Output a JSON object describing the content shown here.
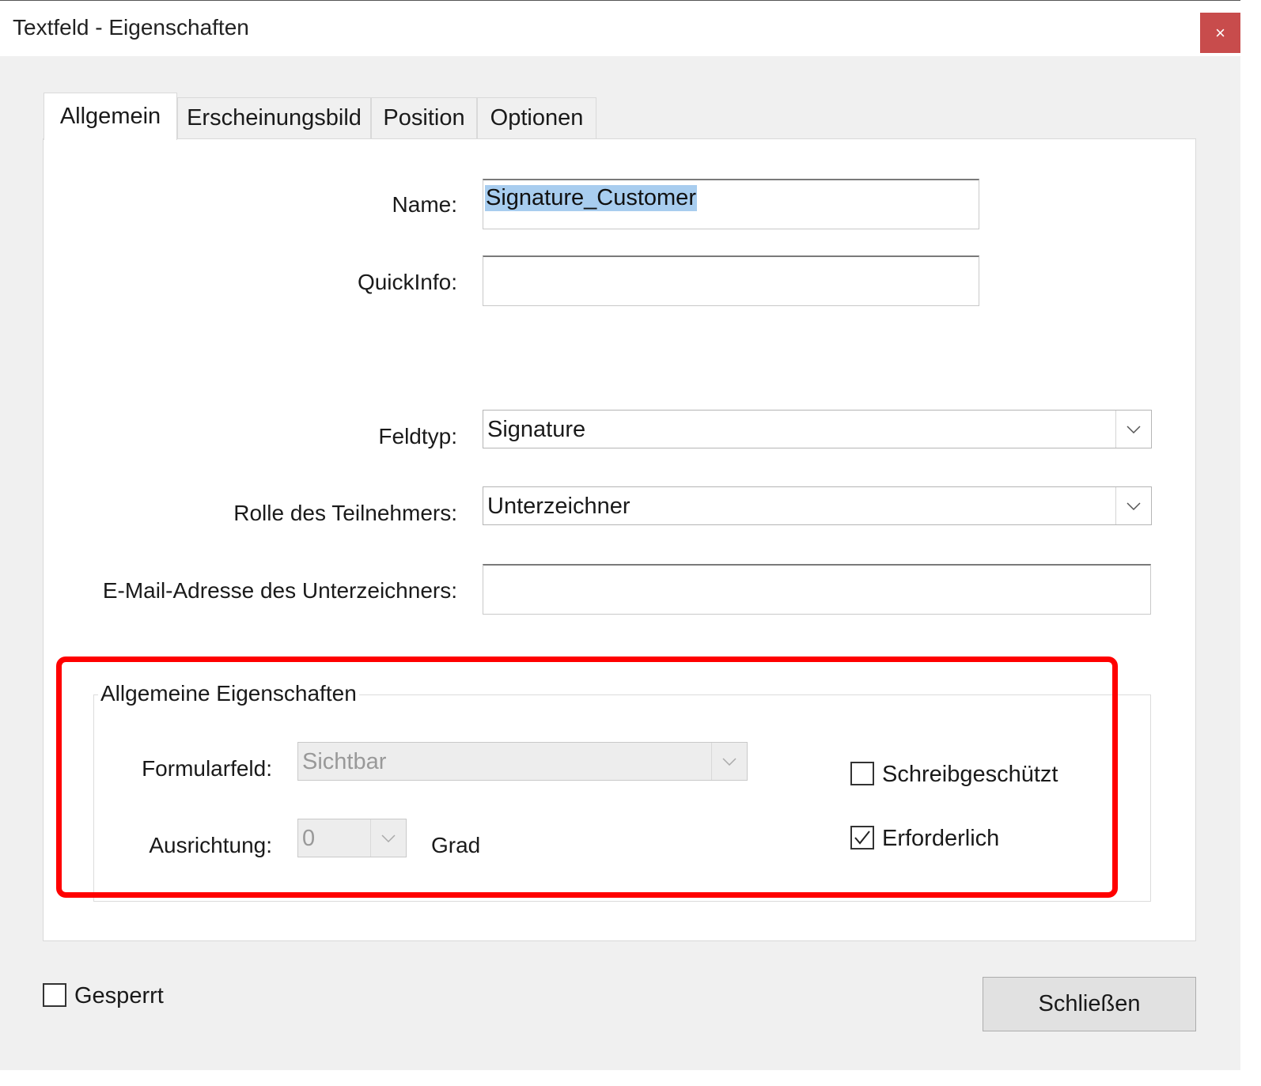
{
  "window": {
    "title": "Textfeld - Eigenschaften",
    "close_glyph": "×"
  },
  "tabs": [
    {
      "label": "Allgemein",
      "active": true
    },
    {
      "label": "Erscheinungsbild",
      "active": false
    },
    {
      "label": "Position",
      "active": false
    },
    {
      "label": "Optionen",
      "active": false
    }
  ],
  "fields": {
    "name_label": "Name:",
    "name_value": "Signature_Customer",
    "quickinfo_label": "QuickInfo:",
    "quickinfo_value": "",
    "feldtyp_label": "Feldtyp:",
    "feldtyp_value": "Signature",
    "rolle_label": "Rolle des Teilnehmers:",
    "rolle_value": "Unterzeichner",
    "email_label": "E-Mail-Adresse des Unterzeichners:",
    "email_value": ""
  },
  "general": {
    "title": "Allgemeine Eigenschaften",
    "formularfeld_label": "Formularfeld:",
    "formularfeld_value": "Sichtbar",
    "ausrichtung_label": "Ausrichtung:",
    "ausrichtung_value": "0",
    "grad_label": "Grad",
    "schreibgeschuetzt_label": "Schreibgeschützt",
    "schreibgeschuetzt_checked": false,
    "erforderlich_label": "Erforderlich",
    "erforderlich_checked": true
  },
  "footer": {
    "gesperrt_label": "Gesperrt",
    "gesperrt_checked": false,
    "close_label": "Schließen"
  },
  "colors": {
    "highlight": "#ff0000",
    "close_button": "#c84c4c",
    "text_selection": "#a8cdef"
  }
}
